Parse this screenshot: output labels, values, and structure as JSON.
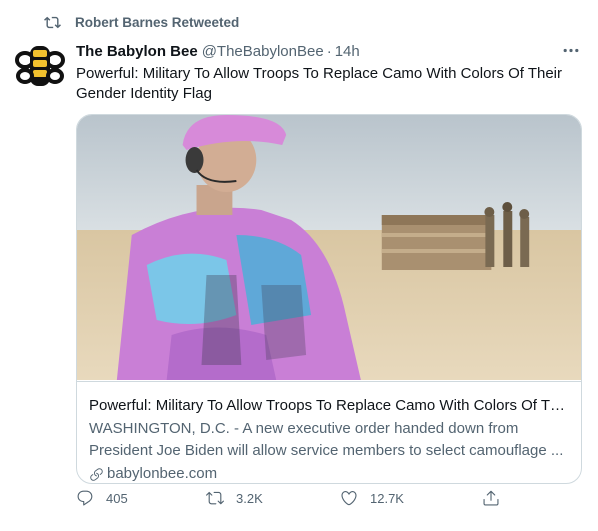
{
  "retweet_header": {
    "label": "Robert Barnes Retweeted"
  },
  "tweet": {
    "author_name": "The Babylon Bee",
    "handle": "@TheBabylonBee",
    "separator": "·",
    "time": "14h",
    "text_line1": "Powerful: Military To Allow Troops To Replace Camo With Colors Of Their",
    "text_line2": "Gender Identity Flag"
  },
  "card": {
    "title": "Powerful: Military To Allow Troops To Replace Camo With Colors Of Th...",
    "desc_line1": "WASHINGTON, D.C. - A new executive order handed down from",
    "desc_line2": "President Joe Biden will allow service members to select camouflage ...",
    "domain": "babylonbee.com"
  },
  "actions": {
    "reply_count": "405",
    "retweet_count": "3.2K",
    "like_count": "12.7K"
  },
  "icons": {
    "retweet_header": "retweet-icon",
    "more": "more-options-icon",
    "reply": "reply-icon",
    "retweet": "retweet-icon",
    "like": "heart-icon",
    "share": "share-icon",
    "link": "link-icon"
  },
  "colors": {
    "text_primary": "#0f1419",
    "text_secondary": "#536471",
    "border": "#cfd9de",
    "logo_yellow": "#f2c12e"
  }
}
